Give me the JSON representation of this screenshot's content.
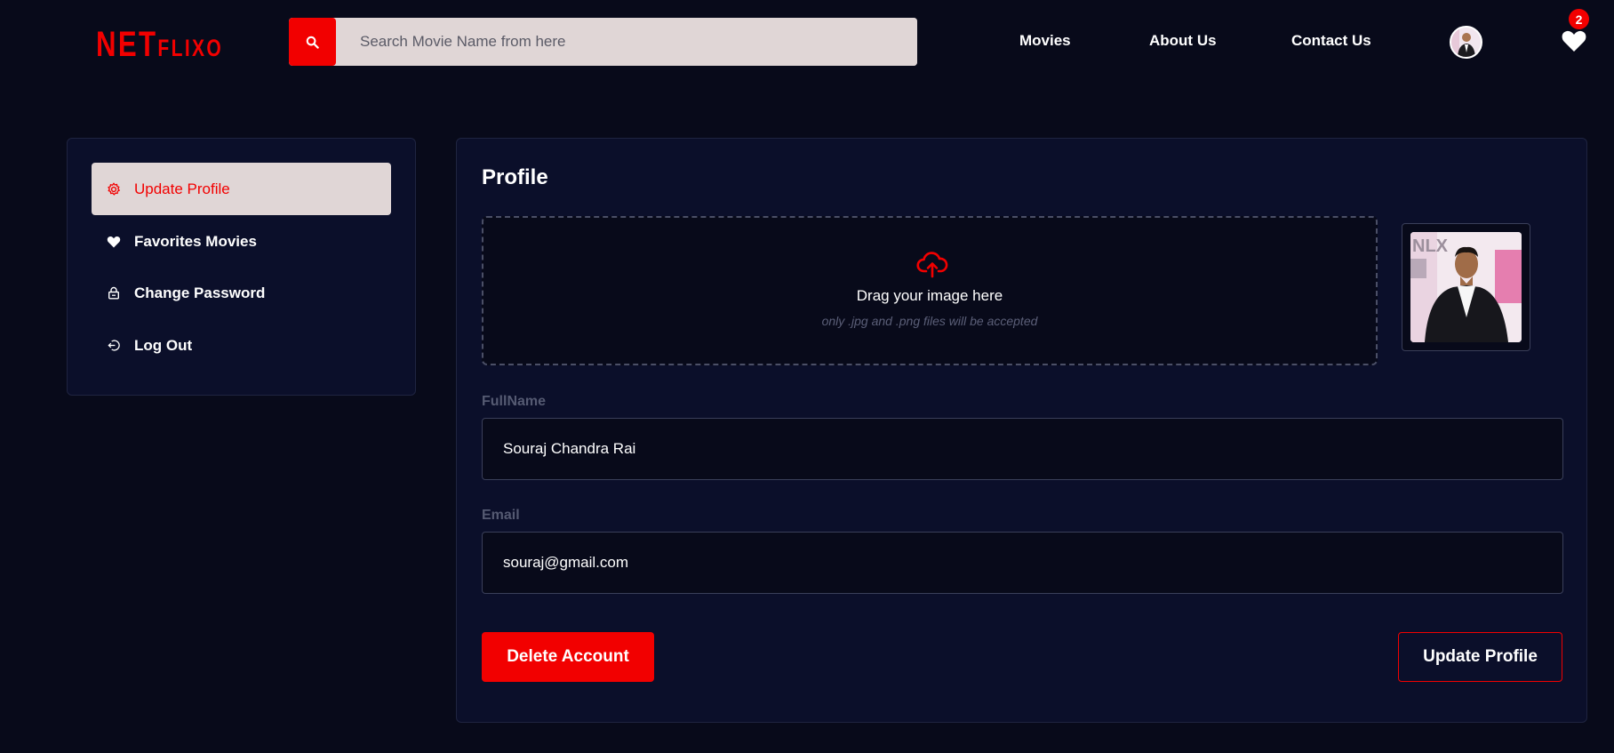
{
  "header": {
    "logo_big": "NET",
    "logo_small": "FLIXO",
    "search": {
      "placeholder": "Search Movie Name from here",
      "value": ""
    },
    "nav": [
      {
        "label": "Movies"
      },
      {
        "label": "About Us"
      },
      {
        "label": "Contact Us"
      }
    ],
    "favorites_count": "2"
  },
  "sidebar": {
    "items": [
      {
        "label": "Update Profile",
        "icon": "gear-icon",
        "active": true
      },
      {
        "label": "Favorites Movies",
        "icon": "heart-icon",
        "active": false
      },
      {
        "label": "Change Password",
        "icon": "lock-icon",
        "active": false
      },
      {
        "label": "Log Out",
        "icon": "logout-icon",
        "active": false
      }
    ]
  },
  "profile": {
    "title": "Profile",
    "dropzone": {
      "text": "Drag your image here",
      "subtext": "only .jpg and .png files will be accepted"
    },
    "fullname": {
      "label": "FullName",
      "value": "Souraj Chandra Rai"
    },
    "email": {
      "label": "Email",
      "value": "souraj@gmail.com"
    },
    "delete_label": "Delete Account",
    "update_label": "Update Profile"
  },
  "colors": {
    "accent": "#f20000",
    "background": "#080a1a",
    "panel": "#0b0f2a",
    "active_item_bg": "#e0d6d6"
  }
}
